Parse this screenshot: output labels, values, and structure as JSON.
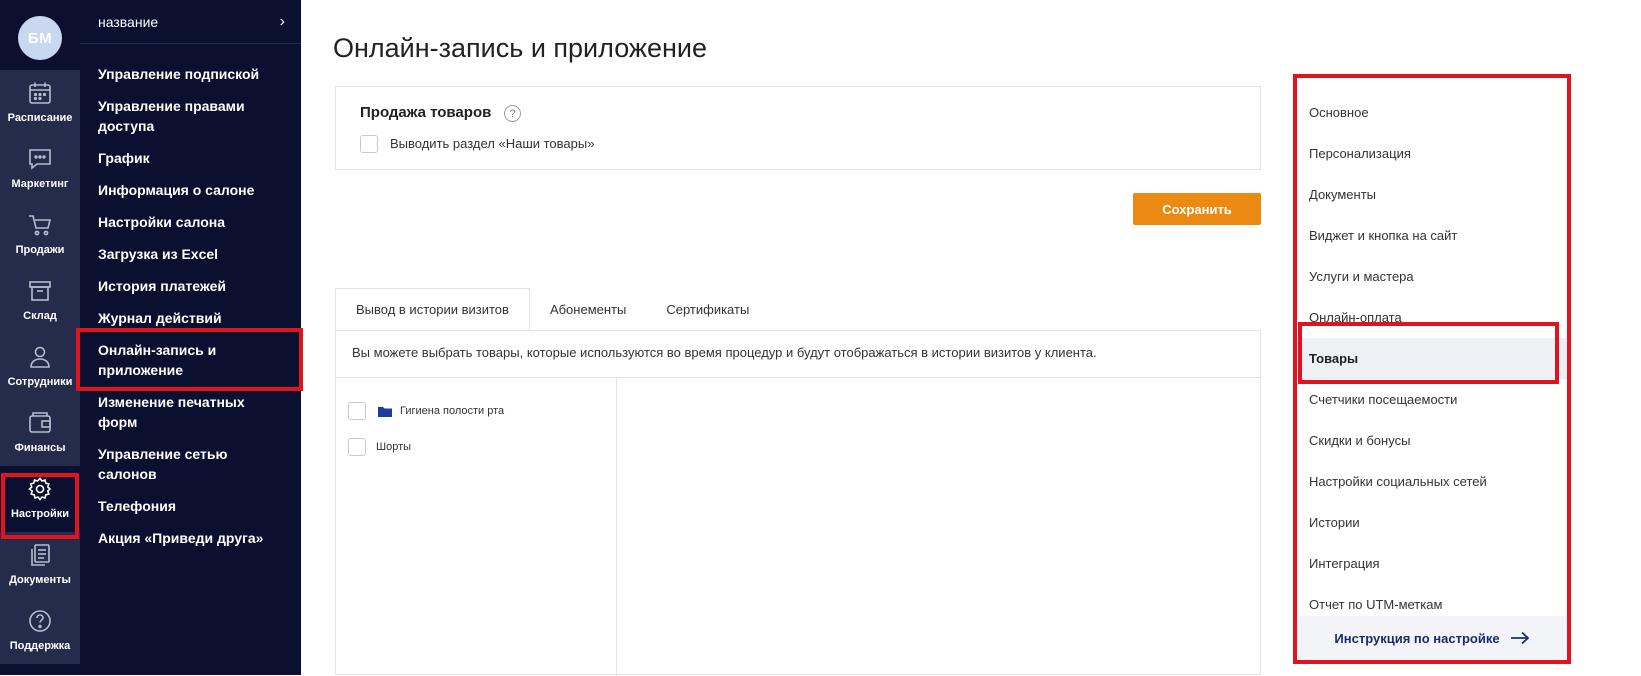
{
  "user": {
    "initials": "БМ"
  },
  "rail": {
    "items": [
      {
        "label": "Расписание",
        "icon": "calendar-icon"
      },
      {
        "label": "Маркетинг",
        "icon": "chat-icon"
      },
      {
        "label": "Продажи",
        "icon": "cart-icon"
      },
      {
        "label": "Склад",
        "icon": "box-icon"
      },
      {
        "label": "Сотрудники",
        "icon": "person-icon"
      },
      {
        "label": "Финансы",
        "icon": "wallet-icon"
      },
      {
        "label": "Настройки",
        "icon": "gear-icon"
      },
      {
        "label": "Документы",
        "icon": "documents-icon"
      },
      {
        "label": "Поддержка",
        "icon": "help-icon"
      }
    ]
  },
  "submenu": {
    "header": "название",
    "items": [
      "Управление подпиской",
      "Управление правами доступа",
      "График",
      "Информация о салоне",
      "Настройки салона",
      "Загрузка из Excel",
      "История платежей",
      "Журнал действий",
      "Онлайн-запись и приложение",
      "Изменение печатных форм",
      "Управление сетью салонов",
      "Телефония",
      "Акция «Приведи друга»"
    ]
  },
  "main": {
    "title": "Онлайн-запись и приложение",
    "card": {
      "title": "Продажа товаров",
      "help": "?",
      "checkbox_label": "Выводить раздел «Наши товары»"
    },
    "save_label": "Сохранить",
    "tabs": [
      "Вывод в истории визитов",
      "Абонементы",
      "Сертификаты"
    ],
    "description": "Вы можете выбрать товары, которые используются во время процедур и будут отображаться в истории визитов у клиента.",
    "tree": [
      {
        "label": "Гигиена полости рта",
        "folder": true
      },
      {
        "label": "Шорты",
        "folder": false
      }
    ]
  },
  "right_nav": {
    "items": [
      "Основное",
      "Персонализация",
      "Документы",
      "Виджет и кнопка на сайт",
      "Услуги и мастера",
      "Онлайн-оплата",
      "Товары",
      "Счетчики посещаемости",
      "Скидки и бонусы",
      "Настройки социальных сетей",
      "Истории",
      "Интеграция",
      "Отчет по UTM-меткам"
    ],
    "active": "Товары",
    "footer": "Инструкция по настройке"
  },
  "colors": {
    "sidebar": "#0b1030",
    "rail_item": "#252b4a",
    "accent_orange": "#eb8a12",
    "highlight_red": "#e0141e",
    "folder_blue": "#1e3c9c"
  }
}
